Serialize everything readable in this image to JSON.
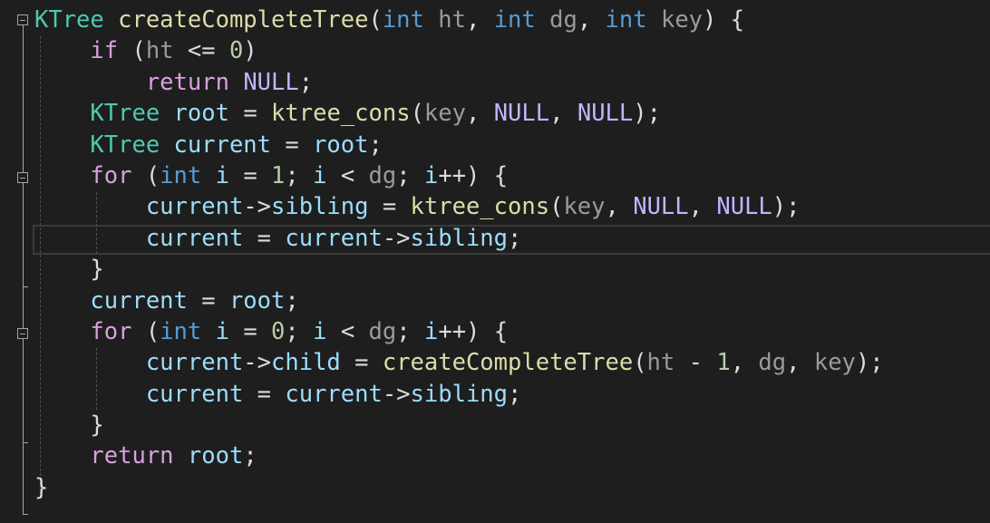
{
  "code": {
    "lines": [
      [
        {
          "t": "KTree",
          "c": "type"
        },
        {
          "t": " ",
          "c": "punc"
        },
        {
          "t": "createCompleteTree",
          "c": "fn"
        },
        {
          "t": "(",
          "c": "punc"
        },
        {
          "t": "int",
          "c": "kw"
        },
        {
          "t": " ",
          "c": "punc"
        },
        {
          "t": "ht",
          "c": "param"
        },
        {
          "t": ", ",
          "c": "punc"
        },
        {
          "t": "int",
          "c": "kw"
        },
        {
          "t": " ",
          "c": "punc"
        },
        {
          "t": "dg",
          "c": "param"
        },
        {
          "t": ", ",
          "c": "punc"
        },
        {
          "t": "int",
          "c": "kw"
        },
        {
          "t": " ",
          "c": "punc"
        },
        {
          "t": "key",
          "c": "param"
        },
        {
          "t": ") {",
          "c": "punc"
        }
      ],
      [
        {
          "t": "    ",
          "c": "punc"
        },
        {
          "t": "if",
          "c": "ctl"
        },
        {
          "t": " (",
          "c": "punc"
        },
        {
          "t": "ht",
          "c": "param"
        },
        {
          "t": " <= ",
          "c": "punc"
        },
        {
          "t": "0",
          "c": "num"
        },
        {
          "t": ")",
          "c": "punc"
        }
      ],
      [
        {
          "t": "        ",
          "c": "punc"
        },
        {
          "t": "return",
          "c": "ctl"
        },
        {
          "t": " ",
          "c": "punc"
        },
        {
          "t": "NULL",
          "c": "mac"
        },
        {
          "t": ";",
          "c": "punc"
        }
      ],
      [
        {
          "t": "    ",
          "c": "punc"
        },
        {
          "t": "KTree",
          "c": "type"
        },
        {
          "t": " ",
          "c": "punc"
        },
        {
          "t": "root",
          "c": "var"
        },
        {
          "t": " = ",
          "c": "punc"
        },
        {
          "t": "ktree_cons",
          "c": "fn"
        },
        {
          "t": "(",
          "c": "punc"
        },
        {
          "t": "key",
          "c": "param"
        },
        {
          "t": ", ",
          "c": "punc"
        },
        {
          "t": "NULL",
          "c": "mac"
        },
        {
          "t": ", ",
          "c": "punc"
        },
        {
          "t": "NULL",
          "c": "mac"
        },
        {
          "t": ");",
          "c": "punc"
        }
      ],
      [
        {
          "t": "    ",
          "c": "punc"
        },
        {
          "t": "KTree",
          "c": "type"
        },
        {
          "t": " ",
          "c": "punc"
        },
        {
          "t": "current",
          "c": "var"
        },
        {
          "t": " = ",
          "c": "punc"
        },
        {
          "t": "root",
          "c": "var"
        },
        {
          "t": ";",
          "c": "punc"
        }
      ],
      [
        {
          "t": "    ",
          "c": "punc"
        },
        {
          "t": "for",
          "c": "ctl"
        },
        {
          "t": " (",
          "c": "punc"
        },
        {
          "t": "int",
          "c": "kw"
        },
        {
          "t": " ",
          "c": "punc"
        },
        {
          "t": "i",
          "c": "var"
        },
        {
          "t": " = ",
          "c": "punc"
        },
        {
          "t": "1",
          "c": "num"
        },
        {
          "t": "; ",
          "c": "punc"
        },
        {
          "t": "i",
          "c": "var"
        },
        {
          "t": " < ",
          "c": "punc"
        },
        {
          "t": "dg",
          "c": "param"
        },
        {
          "t": "; ",
          "c": "punc"
        },
        {
          "t": "i",
          "c": "var"
        },
        {
          "t": "++) {",
          "c": "punc"
        }
      ],
      [
        {
          "t": "        ",
          "c": "punc"
        },
        {
          "t": "current",
          "c": "var"
        },
        {
          "t": "->",
          "c": "punc"
        },
        {
          "t": "sibling",
          "c": "var"
        },
        {
          "t": " = ",
          "c": "punc"
        },
        {
          "t": "ktree_cons",
          "c": "fn"
        },
        {
          "t": "(",
          "c": "punc"
        },
        {
          "t": "key",
          "c": "param"
        },
        {
          "t": ", ",
          "c": "punc"
        },
        {
          "t": "NULL",
          "c": "mac"
        },
        {
          "t": ", ",
          "c": "punc"
        },
        {
          "t": "NULL",
          "c": "mac"
        },
        {
          "t": ");",
          "c": "punc"
        }
      ],
      [
        {
          "t": "        ",
          "c": "punc"
        },
        {
          "t": "current",
          "c": "var"
        },
        {
          "t": " = ",
          "c": "punc"
        },
        {
          "t": "current",
          "c": "var"
        },
        {
          "t": "->",
          "c": "punc"
        },
        {
          "t": "sibling",
          "c": "var"
        },
        {
          "t": ";",
          "c": "punc"
        }
      ],
      [
        {
          "t": "    }",
          "c": "punc"
        }
      ],
      [
        {
          "t": "    ",
          "c": "punc"
        },
        {
          "t": "current",
          "c": "var"
        },
        {
          "t": " = ",
          "c": "punc"
        },
        {
          "t": "root",
          "c": "var"
        },
        {
          "t": ";",
          "c": "punc"
        }
      ],
      [
        {
          "t": "    ",
          "c": "punc"
        },
        {
          "t": "for",
          "c": "ctl"
        },
        {
          "t": " (",
          "c": "punc"
        },
        {
          "t": "int",
          "c": "kw"
        },
        {
          "t": " ",
          "c": "punc"
        },
        {
          "t": "i",
          "c": "var"
        },
        {
          "t": " = ",
          "c": "punc"
        },
        {
          "t": "0",
          "c": "num"
        },
        {
          "t": "; ",
          "c": "punc"
        },
        {
          "t": "i",
          "c": "var"
        },
        {
          "t": " < ",
          "c": "punc"
        },
        {
          "t": "dg",
          "c": "param"
        },
        {
          "t": "; ",
          "c": "punc"
        },
        {
          "t": "i",
          "c": "var"
        },
        {
          "t": "++) {",
          "c": "punc"
        }
      ],
      [
        {
          "t": "        ",
          "c": "punc"
        },
        {
          "t": "current",
          "c": "var"
        },
        {
          "t": "->",
          "c": "punc"
        },
        {
          "t": "child",
          "c": "var"
        },
        {
          "t": " = ",
          "c": "punc"
        },
        {
          "t": "createCompleteTree",
          "c": "fn"
        },
        {
          "t": "(",
          "c": "punc"
        },
        {
          "t": "ht",
          "c": "param"
        },
        {
          "t": " - ",
          "c": "punc"
        },
        {
          "t": "1",
          "c": "num"
        },
        {
          "t": ", ",
          "c": "punc"
        },
        {
          "t": "dg",
          "c": "param"
        },
        {
          "t": ", ",
          "c": "punc"
        },
        {
          "t": "key",
          "c": "param"
        },
        {
          "t": ");",
          "c": "punc"
        }
      ],
      [
        {
          "t": "        ",
          "c": "punc"
        },
        {
          "t": "current",
          "c": "var"
        },
        {
          "t": " = ",
          "c": "punc"
        },
        {
          "t": "current",
          "c": "var"
        },
        {
          "t": "->",
          "c": "punc"
        },
        {
          "t": "sibling",
          "c": "var"
        },
        {
          "t": ";",
          "c": "punc"
        }
      ],
      [
        {
          "t": "    }",
          "c": "punc"
        }
      ],
      [
        {
          "t": "    ",
          "c": "punc"
        },
        {
          "t": "return",
          "c": "ctl"
        },
        {
          "t": " ",
          "c": "punc"
        },
        {
          "t": "root",
          "c": "var"
        },
        {
          "t": ";",
          "c": "punc"
        }
      ],
      [
        {
          "t": "}",
          "c": "punc"
        }
      ]
    ]
  },
  "folding": {
    "toggles": [
      "fold-function",
      "fold-for-loop-1",
      "fold-for-loop-2"
    ]
  },
  "colors": {
    "background": "#1e1e1e",
    "keyword": "#569cd6",
    "control": "#d8a0df",
    "type": "#4ec9b0",
    "function": "#dcdcaa",
    "variable": "#9cdcfe",
    "parameter": "#9a9a9a",
    "number": "#b5cea8",
    "macro": "#beb7ff",
    "punctuation": "#dcdcdc"
  }
}
